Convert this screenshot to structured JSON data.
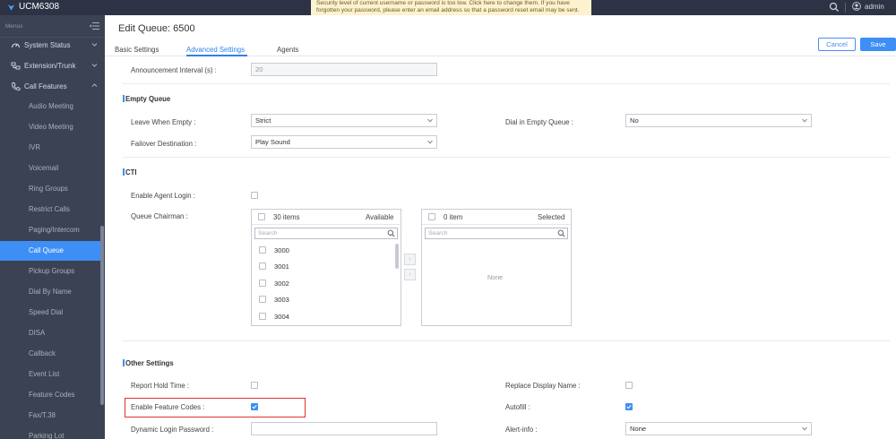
{
  "app": {
    "name": "UCM6308"
  },
  "alert": {
    "text": "Security level of current username or password is too low. Click here to change them. If you have forgotten your password, please enter an email address so that a password reset email may be sent."
  },
  "topbar": {
    "user": "admin"
  },
  "sidebar": {
    "menus_label": "Menus",
    "groups": [
      {
        "label": "System Status",
        "icon": "gauge-icon"
      },
      {
        "label": "Extension/Trunk",
        "icon": "extension-icon"
      },
      {
        "label": "Call Features",
        "icon": "phone-icon"
      }
    ],
    "items": [
      {
        "label": "Audio Meeting"
      },
      {
        "label": "Video Meeting"
      },
      {
        "label": "IVR"
      },
      {
        "label": "Voicemail"
      },
      {
        "label": "Ring Groups"
      },
      {
        "label": "Restrict Calls"
      },
      {
        "label": "Paging/Intercom"
      },
      {
        "label": "Call Queue",
        "active": true
      },
      {
        "label": "Pickup Groups"
      },
      {
        "label": "Dial By Name"
      },
      {
        "label": "Speed Dial"
      },
      {
        "label": "DISA"
      },
      {
        "label": "Callback"
      },
      {
        "label": "Event List"
      },
      {
        "label": "Feature Codes"
      },
      {
        "label": "Fax/T.38"
      },
      {
        "label": "Parking Lot"
      }
    ]
  },
  "page": {
    "title": "Edit Queue: 6500",
    "tabs": [
      "Basic Settings",
      "Advanced Settings",
      "Agents"
    ],
    "active_tab": "Advanced Settings",
    "cancel_label": "Cancel",
    "save_label": "Save"
  },
  "form": {
    "announcement_interval": {
      "label": "Announcement Interval (s) :",
      "value": "20"
    },
    "empty_queue": {
      "title": "Empty Queue",
      "leave_when_empty": {
        "label": "Leave When Empty :",
        "value": "Strict"
      },
      "dial_in_empty_queue": {
        "label": "Dial in Empty Queue :",
        "value": "No"
      },
      "failover_destination": {
        "label": "Failover Destination :",
        "value": "Play Sound"
      }
    },
    "cti": {
      "title": "CTI",
      "enable_agent_login": {
        "label": "Enable Agent Login :",
        "checked": false
      },
      "queue_chairman": {
        "label": "Queue Chairman :"
      },
      "available": {
        "count_label": "30 items",
        "title": "Available",
        "search_placeholder": "Search",
        "items": [
          "3000",
          "3001",
          "3002",
          "3003",
          "3004"
        ]
      },
      "selected": {
        "count_label": "0 item",
        "title": "Selected",
        "search_placeholder": "Search",
        "empty_text": "None"
      }
    },
    "other_settings": {
      "title": "Other Settings",
      "report_hold_time": {
        "label": "Report Hold Time :",
        "checked": false
      },
      "replace_display_name": {
        "label": "Replace Display Name :",
        "checked": false
      },
      "enable_feature_codes": {
        "label": "Enable Feature Codes :",
        "checked": true
      },
      "autofill": {
        "label": "Autofill :",
        "checked": true
      },
      "dynamic_login_password": {
        "label": "Dynamic Login Password :",
        "value": ""
      },
      "alert_info": {
        "label": "Alert-info :",
        "value": "None"
      }
    }
  },
  "colors": {
    "accent": "#3d8ff5",
    "sidebar": "#3a4254",
    "topbar": "#2d3344",
    "highlight": "#e0322f"
  }
}
